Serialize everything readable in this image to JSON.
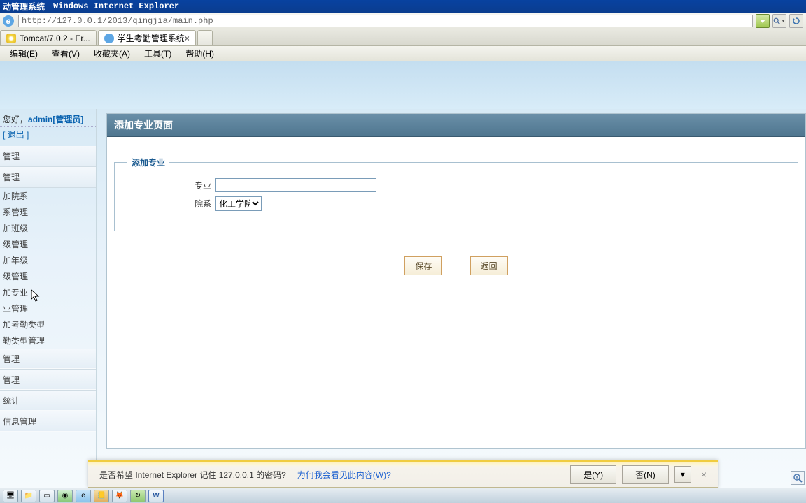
{
  "title_app": "动管理系统",
  "title_browser": "Windows Internet Explorer",
  "url": "http://127.0.0.1/2013/qingjia/main.php",
  "tabs": [
    {
      "label": "Tomcat/7.0.2 - Er..."
    },
    {
      "label": "学生考勤管理系统"
    }
  ],
  "menu": {
    "edit": "编辑(E)",
    "view": "查看(V)",
    "fav": "收藏夹(A)",
    "tools": "工具(T)",
    "help": "帮助(H)"
  },
  "sidebar": {
    "greeting_prefix": "您好，",
    "user": "admin",
    "role": "[管理员]",
    "logout": "[ 退出 ]",
    "sections": [
      "管理",
      "管理"
    ],
    "items": [
      "加院系",
      "系管理",
      "加班级",
      "级管理",
      "加年级",
      "级管理",
      "加专业",
      "业管理",
      "加考勤类型",
      "勤类型管理"
    ],
    "tail_sections": [
      "管理",
      "管理",
      "统计",
      "信息管理"
    ]
  },
  "panel": {
    "title": "添加专业页面",
    "legend": "添加专业",
    "label_major": "专业",
    "label_dept": "院系",
    "dept_value": "化工学院",
    "btn_save": "保存",
    "btn_back": "返回"
  },
  "infobar": {
    "msg": "是否希望 Internet Explorer 记住 127.0.0.1 的密码?",
    "link": "为何我会看见此内容(W)?",
    "yes": "是(Y)",
    "no": "否(N)"
  }
}
